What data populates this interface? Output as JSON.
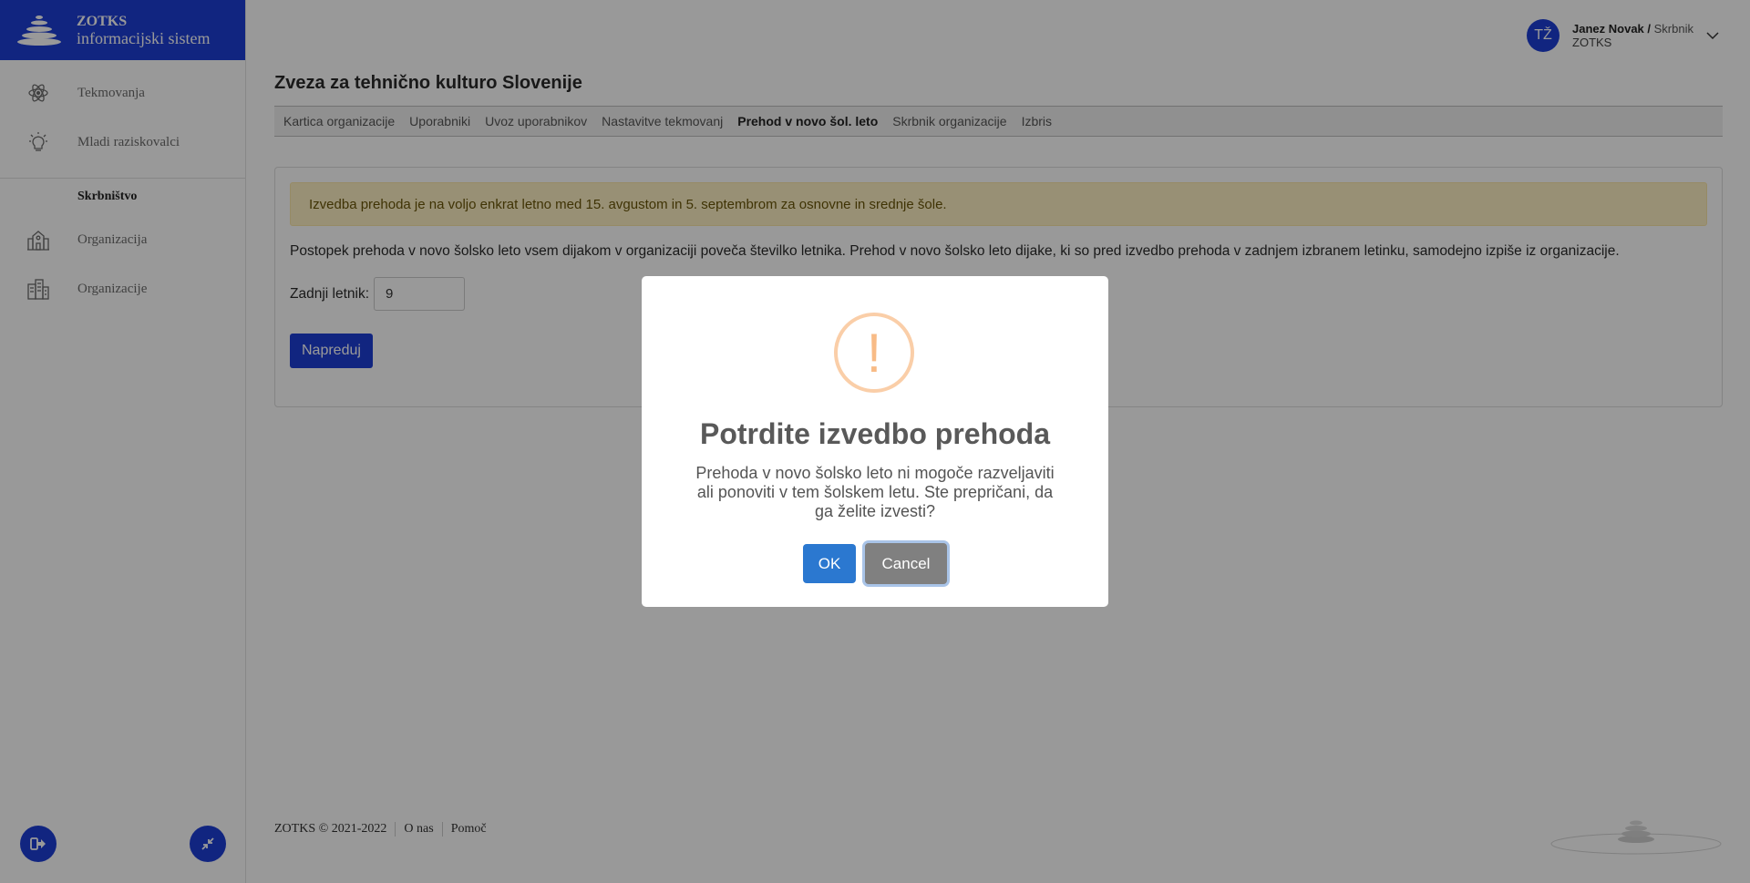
{
  "brand": {
    "title": "ZOTKS",
    "subtitle": "informacijski sistem"
  },
  "sidebar": {
    "items_top": [
      {
        "label": "Tekmovanja",
        "icon": "atom-icon"
      },
      {
        "label": "Mladi raziskovalci",
        "icon": "lightbulb-icon"
      }
    ],
    "section": "Skrbništvo",
    "items_bottom": [
      {
        "label": "Organizacija",
        "icon": "school-building-icon"
      },
      {
        "label": "Organizacije",
        "icon": "city-buildings-icon"
      }
    ]
  },
  "user": {
    "initials": "TŽ",
    "name": "Janez Novak /",
    "role": "Skrbnik",
    "org": "ZOTKS"
  },
  "page": {
    "title": "Zveza za tehnično kulturo Slovenije",
    "tabs": [
      {
        "label": "Kartica organizacije",
        "active": false
      },
      {
        "label": "Uporabniki",
        "active": false
      },
      {
        "label": "Uvoz uporabnikov",
        "active": false
      },
      {
        "label": "Nastavitve tekmovanj",
        "active": false
      },
      {
        "label": "Prehod v novo šol. leto",
        "active": true
      },
      {
        "label": "Skrbnik organizacije",
        "active": false
      },
      {
        "label": "Izbris",
        "active": false
      }
    ],
    "alert": "Izvedba prehoda je na voljo enkrat letno med 15. avgustom in 5. septembrom za osnovne in srednje šole.",
    "description": "Postopek prehoda v novo šolsko leto vsem dijakom v organizaciji poveča številko letnika. Prehod v novo šolsko leto dijake, ki so pred izvedbo prehoda v zadnjem izbranem letinku, samodejno izpiše iz organizacije.",
    "field_label": "Zadnji letnik:",
    "field_value": "9",
    "submit_label": "Napreduj"
  },
  "footer": {
    "copyright": "ZOTKS © 2021-2022",
    "about": "O nas",
    "help": "Pomoč"
  },
  "modal": {
    "icon_glyph": "!",
    "title": "Potrdite izvedbo prehoda",
    "text": "Prehoda v novo šolsko leto ni mogoče razveljaviti ali ponoviti v tem šolskem letu. Ste prepričani, da ga želite izvesti?",
    "ok_label": "OK",
    "cancel_label": "Cancel"
  },
  "colors": {
    "brand": "#1d3ed6",
    "ok": "#2b78d0",
    "cancel": "#808080",
    "warning": "#f8bb86",
    "alert_bg": "#fdf0c4"
  }
}
